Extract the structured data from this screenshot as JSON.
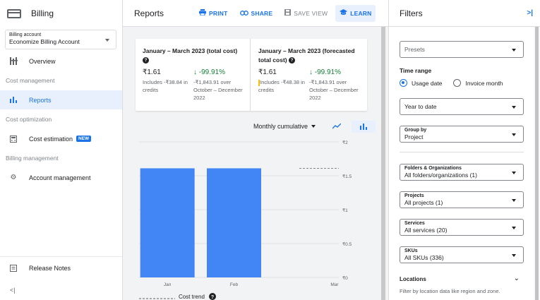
{
  "sidebar": {
    "title": "Billing",
    "account_label": "Billing account",
    "account_value": "Economize Billing Account",
    "items": [
      {
        "label": "Overview",
        "icon": "overview-icon"
      },
      {
        "section": "Cost management"
      },
      {
        "label": "Reports",
        "icon": "bar-chart-icon",
        "active": true
      },
      {
        "section": "Cost optimization"
      },
      {
        "label": "Cost estimation",
        "icon": "calculator-icon",
        "badge": "NEW"
      },
      {
        "section": "Billing management"
      },
      {
        "label": "Account management",
        "icon": "gear-icon"
      }
    ],
    "release_notes": "Release Notes",
    "collapse_glyph": "<|"
  },
  "header": {
    "title": "Reports",
    "print": "PRINT",
    "share": "SHARE",
    "save_view": "SAVE VIEW",
    "learn": "LEARN"
  },
  "summary": {
    "total": {
      "title": "January – March 2023 (total cost)",
      "amount": "₹1.61",
      "delta": "-99.91%",
      "credits_note": "Includes -₹38.84 in credits",
      "compare_note": "-₹1,843.91 over October – December 2022"
    },
    "forecast": {
      "title": "January – March 2023 (forecasted total cost)",
      "amount": "₹1.61",
      "delta": "-99.91%",
      "credits_note": "Includes -₹48.38 in credits",
      "compare_note": "-₹1,843.91 over October – December 2022"
    }
  },
  "chart_controls": {
    "period": "Monthly cumulative",
    "line_toggle": "line-chart-icon",
    "bar_toggle": "bar-chart-icon"
  },
  "chart_data": {
    "type": "bar",
    "categories": [
      "Jan",
      "Feb",
      "Mar"
    ],
    "values": [
      1.61,
      1.61,
      null
    ],
    "y_ticks": [
      "₹0",
      "₹0.5",
      "₹1",
      "₹1.5",
      "₹2"
    ],
    "ylim": [
      0,
      2
    ],
    "forecast_line_value": 1.61,
    "bar_color": "#4285f4",
    "legend": "Cost trend"
  },
  "filters": {
    "title": "Filters",
    "collapse_glyph": ">|",
    "presets_placeholder": "Presets",
    "time_range_label": "Time range",
    "time_options": [
      "Usage date",
      "Invoice month"
    ],
    "time_selected": "Usage date",
    "period_value": "Year to date",
    "group_by_label": "Group by",
    "group_by_value": "Project",
    "folders_label": "Folders & Organizations",
    "folders_value": "All folders/organizations (1)",
    "projects_label": "Projects",
    "projects_value": "All projects (1)",
    "services_label": "Services",
    "services_value": "All services (20)",
    "skus_label": "SKUs",
    "skus_value": "All SKUs (336)",
    "locations_label": "Locations",
    "locations_desc": "Filter by location data like region and zone."
  },
  "colors": {
    "accent": "#1a73e8",
    "active_bg": "#e8f0fe",
    "positive": "#188038",
    "bar": "#4285f4"
  }
}
